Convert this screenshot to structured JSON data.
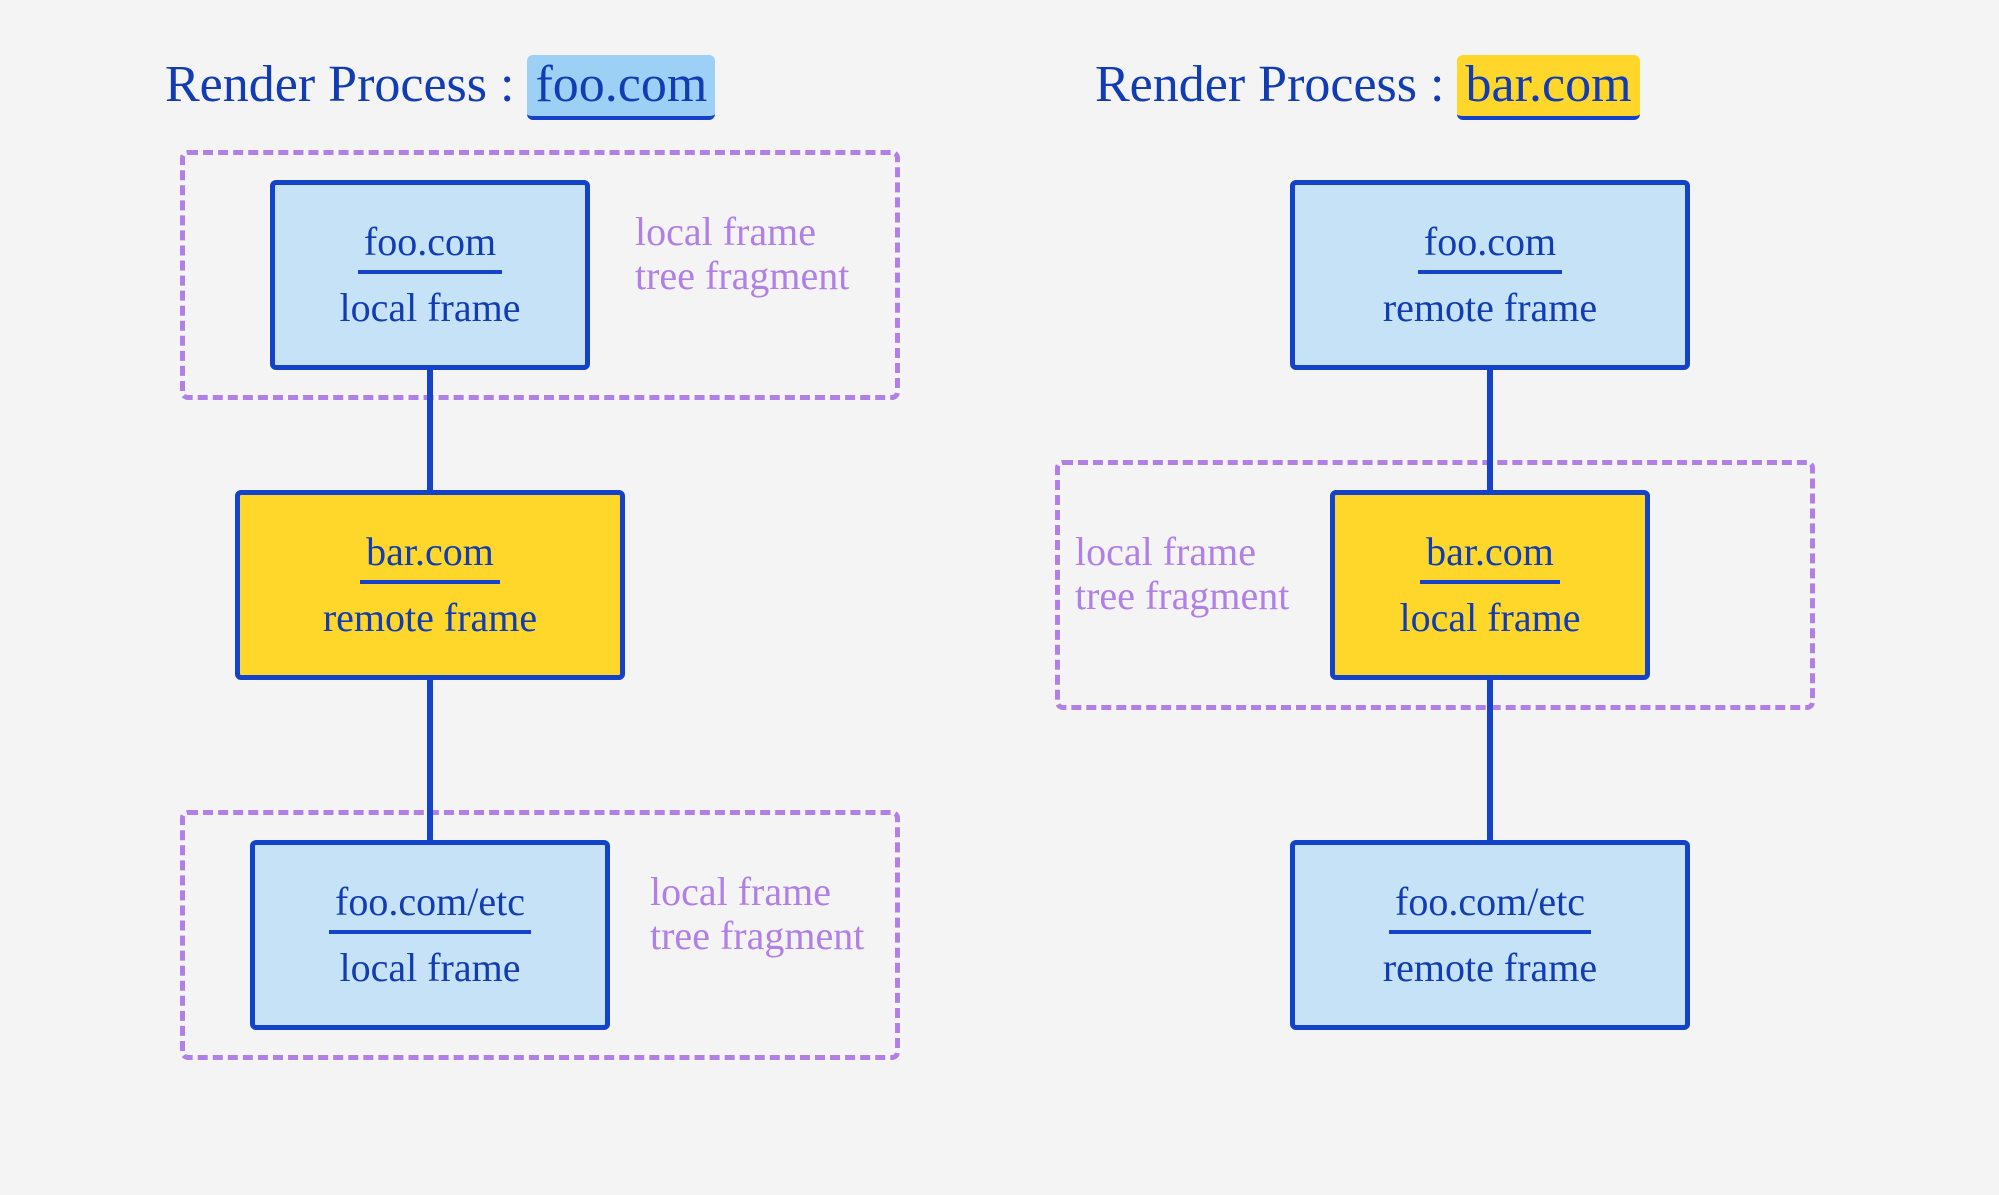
{
  "headings": {
    "left": {
      "prefix": "Render Process :",
      "site": "foo.com",
      "color": "blue"
    },
    "right": {
      "prefix": "Render Process :",
      "site": "bar.com",
      "color": "yellow"
    }
  },
  "fragment_label_line1": "local frame",
  "fragment_label_line2": "tree fragment",
  "left": {
    "n1": {
      "url": "foo.com",
      "kind": "local frame",
      "fill": "blue",
      "fragment": true
    },
    "n2": {
      "url": "bar.com",
      "kind": "remote frame",
      "fill": "yellow",
      "fragment": false
    },
    "n3": {
      "url": "foo.com/etc",
      "kind": "local frame",
      "fill": "blue",
      "fragment": true
    }
  },
  "right": {
    "n1": {
      "url": "foo.com",
      "kind": "remote frame",
      "fill": "blue",
      "fragment": false
    },
    "n2": {
      "url": "bar.com",
      "kind": "local frame",
      "fill": "yellow",
      "fragment": true
    },
    "n3": {
      "url": "foo.com/etc",
      "kind": "remote frame",
      "fill": "blue",
      "fragment": false
    }
  },
  "colors": {
    "ink": "#113cb4",
    "box_border": "#1442c8",
    "fill_blue": "#c6e2f7",
    "fill_yellow": "#ffd72b",
    "dash": "#b180e6"
  }
}
